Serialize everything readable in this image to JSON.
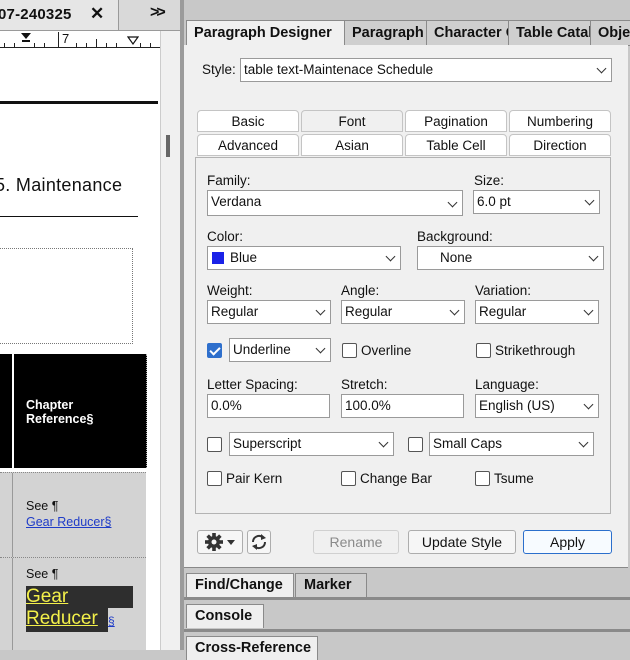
{
  "document": {
    "tab_label": "07-240325",
    "tab_close": "✕",
    "overflow": "»",
    "ruler_number": "7",
    "heading": "5. Maintenance",
    "table_header": "Chapter Reference§",
    "row1_see": "See ¶",
    "row1_link": "Gear Reducer§",
    "row2_see": "See ¶",
    "row2_link_line1": "Gear",
    "row2_link_line2": "Reducer",
    "row2_link_tail": "§"
  },
  "panel_tabs": [
    {
      "label": "Paragraph Designer",
      "active": true
    },
    {
      "label": "Paragraph",
      "active": false
    },
    {
      "label": "Character Catalog",
      "active": false
    },
    {
      "label": "Table Catalog",
      "active": false
    },
    {
      "label": "Object",
      "active": false
    }
  ],
  "designer": {
    "style_label": "Style:",
    "style_value": "table text-Maintenace Schedule",
    "subtabs_row1": [
      "Basic",
      "Font",
      "Pagination",
      "Numbering"
    ],
    "subtabs_row2": [
      "Advanced",
      "Asian",
      "Table Cell",
      "Direction"
    ],
    "active_subtab": "Font",
    "family_label": "Family:",
    "family_value": "Verdana",
    "size_label": "Size:",
    "size_value": "6.0 pt",
    "color_label": "Color:",
    "color_value": "Blue",
    "color_swatch": "#1a22e8",
    "background_label": "Background:",
    "background_value": "None",
    "weight_label": "Weight:",
    "weight_value": "Regular",
    "angle_label": "Angle:",
    "angle_value": "Regular",
    "variation_label": "Variation:",
    "variation_value": "Regular",
    "underline_checked": true,
    "underline_value": "Underline",
    "overline_label": "Overline",
    "overline_checked": false,
    "strikethrough_label": "Strikethrough",
    "strikethrough_checked": false,
    "letter_spacing_label": "Letter Spacing:",
    "letter_spacing_value": "0.0%",
    "stretch_label": "Stretch:",
    "stretch_value": "100.0%",
    "language_label": "Language:",
    "language_value": "English (US)",
    "superscript_checked": false,
    "superscript_value": "Superscript",
    "smallcaps_checked": false,
    "smallcaps_value": "Small Caps",
    "pairkern_label": "Pair Kern",
    "pairkern_checked": false,
    "changebar_label": "Change Bar",
    "changebar_checked": false,
    "tsume_label": "Tsume",
    "tsume_checked": false,
    "rename_label": "Rename",
    "update_style_label": "Update Style",
    "apply_label": "Apply",
    "accent_color": "#2b6fcc"
  },
  "docked_panels": {
    "findchange_label": "Find/Change",
    "marker_label": "Marker",
    "console_label": "Console",
    "crossref_label": "Cross-Reference"
  }
}
